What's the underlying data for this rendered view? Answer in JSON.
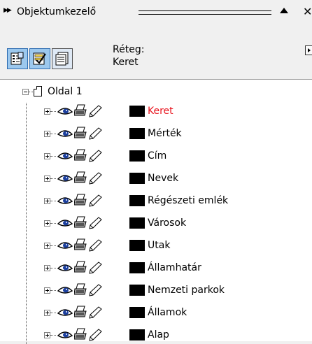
{
  "window": {
    "title": "Objektumkezelő"
  },
  "toolbar": {
    "layer_caption": "Réteg:",
    "layer_name": "Keret"
  },
  "tree": {
    "page": {
      "label": "Oldal 1"
    },
    "layers": [
      {
        "label": "Keret",
        "color": "#e8141e",
        "swatch": "#000000"
      },
      {
        "label": "Mérték",
        "color": "#000000",
        "swatch": "#000000"
      },
      {
        "label": "Cím",
        "color": "#000000",
        "swatch": "#000000"
      },
      {
        "label": "Nevek",
        "color": "#000000",
        "swatch": "#000000"
      },
      {
        "label": "Régészeti emlék",
        "color": "#000000",
        "swatch": "#000000"
      },
      {
        "label": "Városok",
        "color": "#000000",
        "swatch": "#000000"
      },
      {
        "label": "Utak",
        "color": "#000000",
        "swatch": "#000000"
      },
      {
        "label": "Államhatár",
        "color": "#000000",
        "swatch": "#000000"
      },
      {
        "label": "Nemzeti parkok",
        "color": "#000000",
        "swatch": "#000000"
      },
      {
        "label": "Államok",
        "color": "#000000",
        "swatch": "#000000"
      },
      {
        "label": "Alap",
        "color": "#000000",
        "swatch": "#000000"
      }
    ]
  },
  "colors": {
    "accent": "#e8141e",
    "selected_button": "#9cc8ee"
  },
  "icons": [
    "expand-arrows-icon",
    "collapse-panel-icon",
    "close-icon",
    "show-properties-icon",
    "show-layers-icon",
    "layer-view-icon",
    "flyout-menu-icon",
    "page-icon",
    "eye-icon",
    "printer-icon",
    "pencil-icon",
    "color-swatch-icon"
  ]
}
